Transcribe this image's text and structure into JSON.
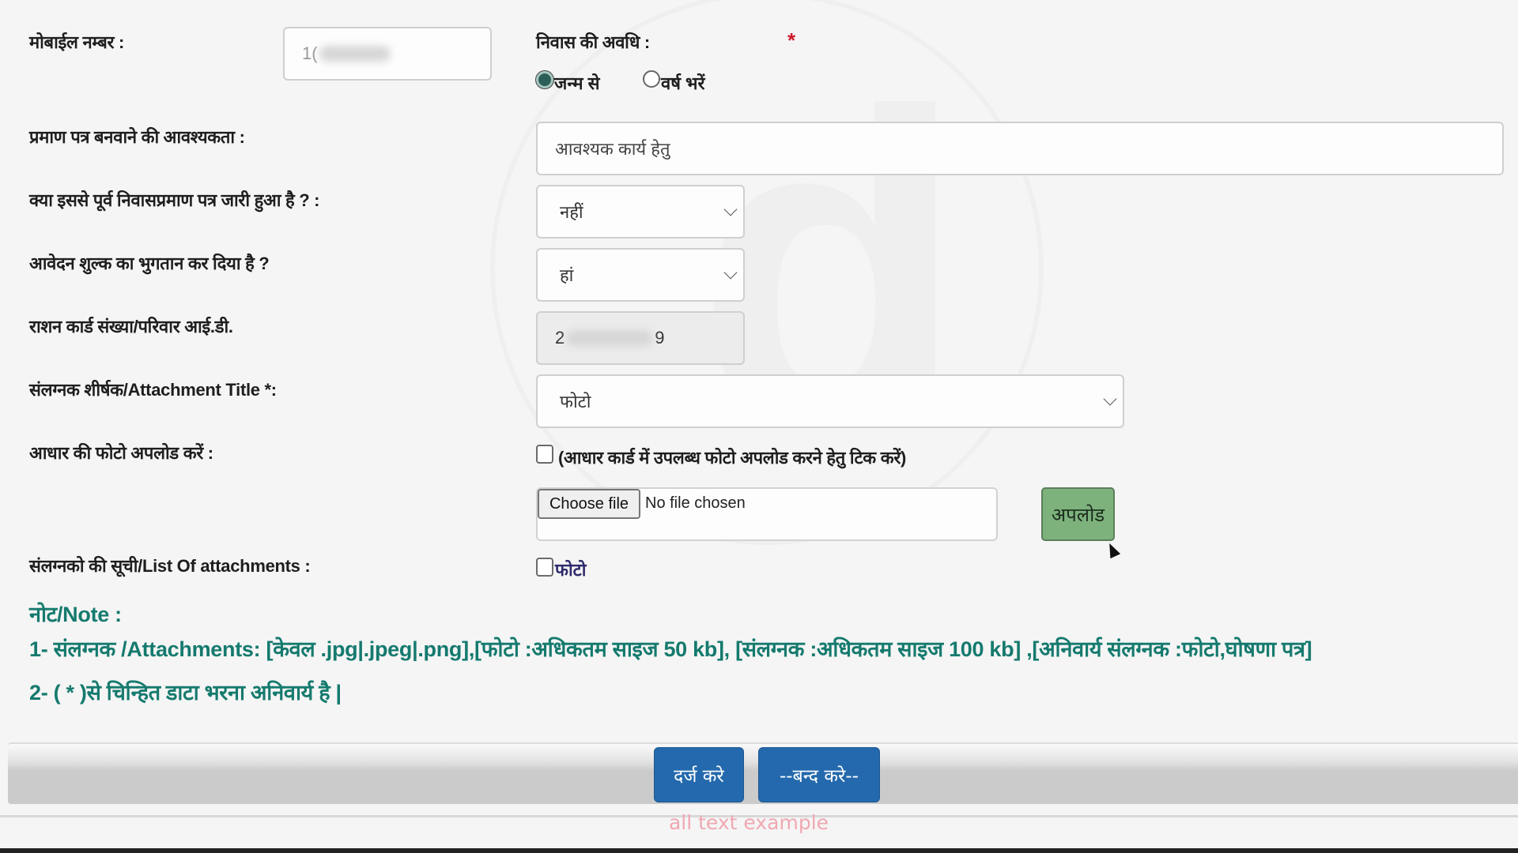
{
  "form": {
    "mobile": {
      "label": "मोबाईल नम्बर :",
      "value_prefix": "1(",
      "value_redacted": true
    },
    "residence_period": {
      "label": "निवास की अवधि :",
      "required_marker": "*",
      "options": [
        {
          "label": "जन्म से",
          "checked": true
        },
        {
          "label": "वर्ष भरें",
          "checked": false
        }
      ]
    },
    "certificate_need": {
      "label": "प्रमाण पत्र बनवाने की आवश्यकता :",
      "value": "आवश्यक कार्य हेतु"
    },
    "previous_certificate": {
      "label": "क्या इससे पूर्व निवासप्रमाण पत्र जारी हुआ है ? :",
      "selected": "नहीं"
    },
    "fee_paid": {
      "label": "आवेदन शुल्क का भुगतान कर दिया है ?",
      "selected": "हां"
    },
    "ration_card": {
      "label": "राशन कार्ड संख्या/परिवार आई.डी.",
      "value_start": "2",
      "value_end": "9",
      "value_redacted": true
    },
    "attachment_title": {
      "label": "संलग्नक शीर्षक/Attachment Title *:",
      "selected": "फोटो"
    },
    "aadhaar_photo": {
      "label": "आधार की फोटो अपलोड करें :",
      "checkbox_label": "(आधार कार्ड में उपलब्ध फोटो अपलोड करने हेतु टिक करें)",
      "checked": false
    },
    "file_input": {
      "button_label": "Choose file",
      "status": "No file chosen"
    },
    "upload_button": "अपलोड",
    "attachments_list": {
      "label": "संलग्नको की सूची/List Of attachments :",
      "items": [
        {
          "label": "फोटो",
          "checked": false
        }
      ]
    }
  },
  "notes": {
    "heading": "नोट/Note :",
    "lines": [
      "1- संलग्नक /Attachments: [केवल .jpg|.jpeg|.png],[फोटो :अधिकतम साइज 50 kb], [संलग्नक :अधिकतम साइज 100 kb] ,[अनिवार्य संलग्नक :फोटो,घोषणा पत्र]",
      "2- ( * )से चिन्हित डाटा भरना अनिवार्य है |"
    ]
  },
  "footer": {
    "submit_label": "दर्ज करे",
    "close_label": "--बन्द करे--",
    "example_text": "all text example"
  },
  "colors": {
    "note_text": "#157a6e",
    "primary_button": "#2469ad",
    "upload_button": "#7db27d",
    "required_marker": "#d0182c",
    "attachment_link": "#2d2a6b",
    "example_text": "#f0a8b2"
  }
}
